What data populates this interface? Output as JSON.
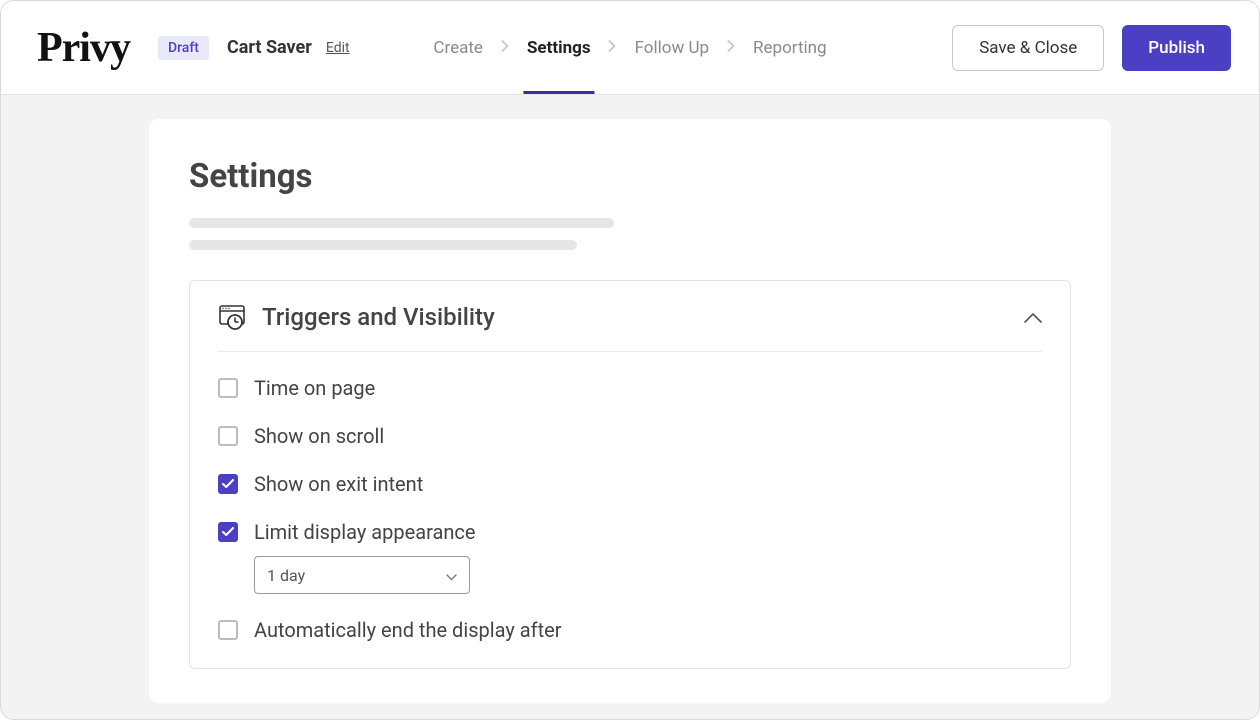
{
  "header": {
    "logo_text": "Privy",
    "draft_badge": "Draft",
    "campaign_name": "Cart Saver",
    "edit_label": "Edit",
    "steps": [
      "Create",
      "Settings",
      "Follow Up",
      "Reporting"
    ],
    "active_step_index": 1,
    "save_close_label": "Save & Close",
    "publish_label": "Publish"
  },
  "settings": {
    "title": "Settings",
    "panel": {
      "title": "Triggers and Visibility",
      "options": {
        "time_on_page": {
          "label": "Time on page",
          "checked": false
        },
        "show_on_scroll": {
          "label": "Show on scroll",
          "checked": false
        },
        "show_on_exit_intent": {
          "label": "Show on exit intent",
          "checked": true
        },
        "limit_display_appearance": {
          "label": "Limit display appearance",
          "checked": true,
          "select_value": "1 day"
        },
        "auto_end_display": {
          "label": "Automatically end the display after",
          "checked": false
        }
      }
    }
  }
}
